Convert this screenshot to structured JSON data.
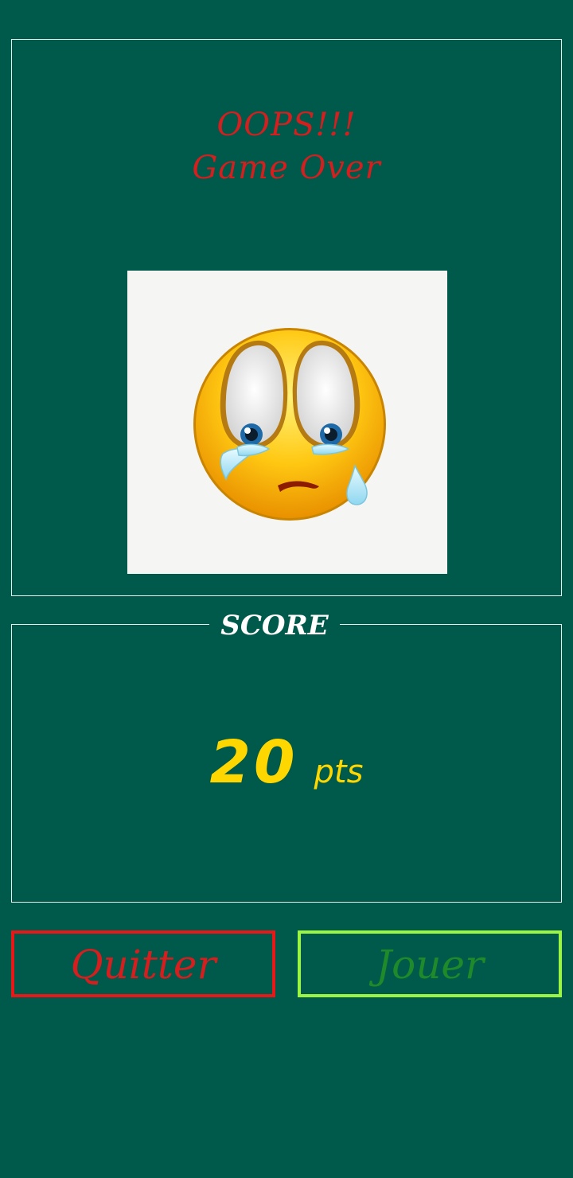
{
  "result": {
    "oops_text": "OOPS!!!",
    "gameover_text": "Game Over",
    "image_icon": "crying-face-icon"
  },
  "score": {
    "legend": "SCORE",
    "value": "20",
    "unit": "pts"
  },
  "actions": {
    "quit_label": "Quitter",
    "play_label": "Jouer"
  },
  "colors": {
    "background": "#005a4b",
    "oops": "#d61e1e",
    "score": "#ffd700",
    "quit_border": "#e81818",
    "play_border": "#9bf542",
    "play_text": "#1f8a2a"
  }
}
